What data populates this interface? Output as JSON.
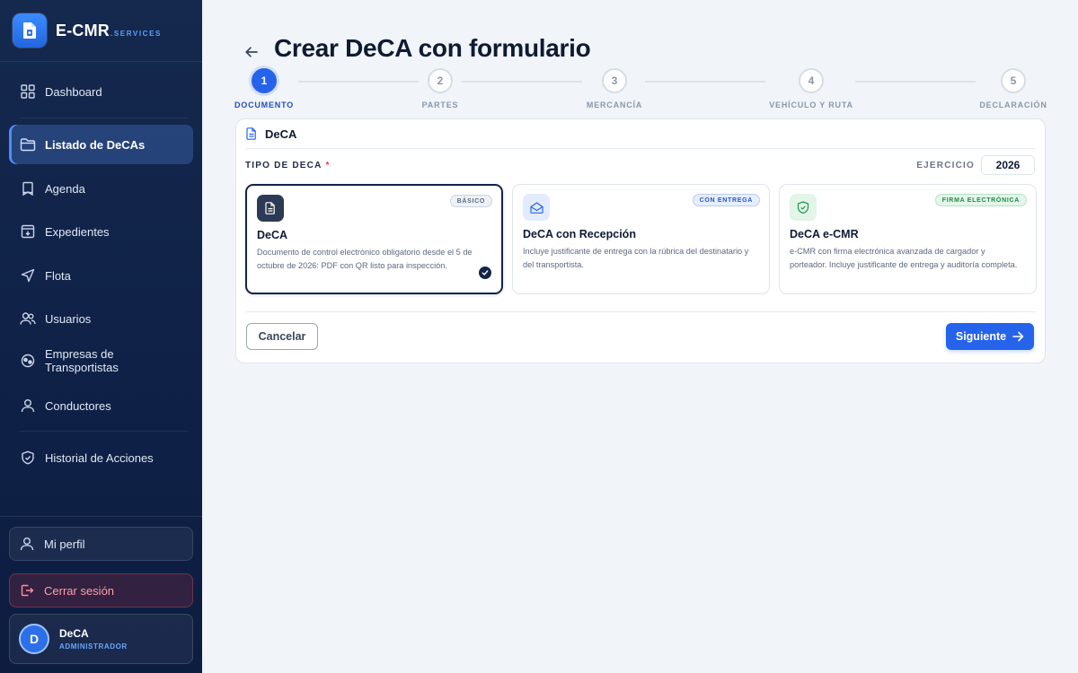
{
  "brand": {
    "name": "E-CMR",
    "suffix": ".SERVICES"
  },
  "sidebar": {
    "items": [
      {
        "label": "Dashboard",
        "icon": "grid-icon",
        "active": false
      },
      {
        "label": "Listado de DeCAs",
        "icon": "folder-icon",
        "active": true
      },
      {
        "label": "Agenda",
        "icon": "bookmark-icon",
        "active": false
      },
      {
        "label": "Expedientes",
        "icon": "archive-icon",
        "active": false
      },
      {
        "label": "Flota",
        "icon": "navigation-icon",
        "active": false
      },
      {
        "label": "Usuarios",
        "icon": "users-icon",
        "active": false
      },
      {
        "label": "Empresas de Transportistas",
        "icon": "globe-icon",
        "active": false
      },
      {
        "label": "Conductores",
        "icon": "user-icon",
        "active": false
      },
      {
        "label": "Historial de Acciones",
        "icon": "shield-icon",
        "active": false
      }
    ],
    "profile_label": "Mi perfil",
    "logout_label": "Cerrar sesión",
    "user": {
      "initial": "D",
      "name": "DeCA",
      "role": "ADMINISTRADOR"
    }
  },
  "page": {
    "title": "Crear DeCA con formulario"
  },
  "stepper": {
    "steps": [
      {
        "num": "1",
        "label": "DOCUMENTO",
        "active": true
      },
      {
        "num": "2",
        "label": "PARTES",
        "active": false
      },
      {
        "num": "3",
        "label": "MERCANCÍA",
        "active": false
      },
      {
        "num": "4",
        "label": "VEHÍCULO Y RUTA",
        "active": false
      },
      {
        "num": "5",
        "label": "DECLARACIÓN",
        "active": false
      }
    ]
  },
  "form": {
    "section_title": "DeCA",
    "tipo_label": "TIPO DE DECA",
    "required_mark": "*",
    "ejercicio_label": "EJERCICIO",
    "ejercicio_value": "2026",
    "options": [
      {
        "title": "DeCA",
        "badge": "BÁSICO",
        "description": "Documento de control electrónico obligatorio desde el 5 de octubre de 2026: PDF con QR listo para inspección.",
        "selected": true,
        "icon": "document-icon"
      },
      {
        "title": "DeCA con Recepción",
        "badge": "CON ENTREGA",
        "description": "Incluye justificante de entrega con la rúbrica del destinatario y del transportista.",
        "selected": false,
        "icon": "mail-icon"
      },
      {
        "title": "DeCA e-CMR",
        "badge": "FIRMA ELECTRÓNICA",
        "description": "e-CMR con firma electrónica avanzada de cargador y porteador. Incluye justificante de entrega y auditoría completa.",
        "selected": false,
        "icon": "shield-check-icon"
      }
    ],
    "cancel_label": "Cancelar",
    "next_label": "Siguiente"
  },
  "colors": {
    "primary": "#2563eb",
    "sidebar": "#0f2147",
    "selected_border": "#142448"
  }
}
